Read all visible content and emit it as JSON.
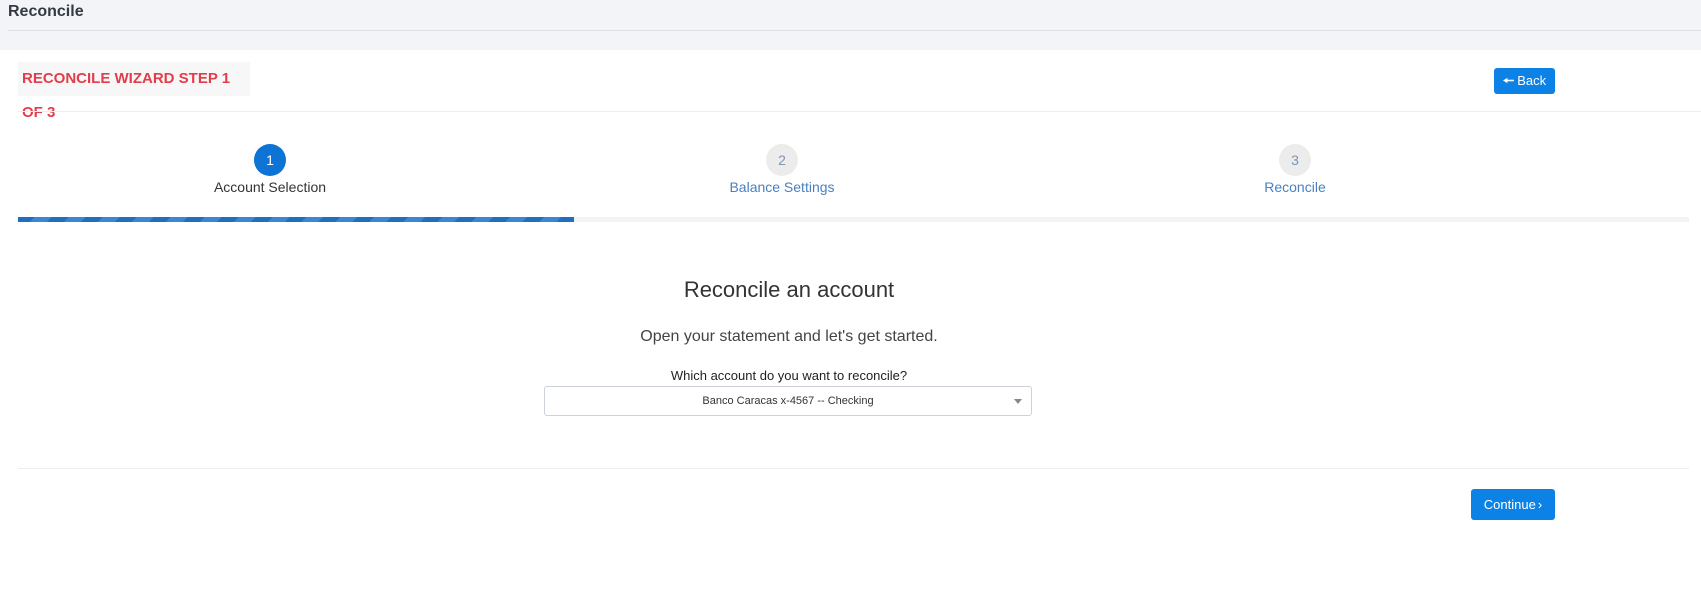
{
  "header": {
    "title": "Reconcile"
  },
  "wizard": {
    "title": "RECONCILE WIZARD STEP 1 OF 3",
    "back_label": "Back",
    "back_icon": "arrow-left-icon",
    "progress_fraction": 0.333,
    "steps": [
      {
        "number": "1",
        "label": "Account Selection",
        "active": true
      },
      {
        "number": "2",
        "label": "Balance Settings",
        "active": false
      },
      {
        "number": "3",
        "label": "Reconcile",
        "active": false
      }
    ]
  },
  "main": {
    "title": "Reconcile an account",
    "subtitle": "Open your statement and let's get started.",
    "select_label": "Which account do you want to reconcile?",
    "selected_account": "Banco Caracas x-4567 -- Checking"
  },
  "footer": {
    "continue_label": "Continue",
    "continue_icon": "chevron-right-icon"
  },
  "colors": {
    "primary": "#0d82e6",
    "title_red": "#e23d4b",
    "step_active": "#0d73d4"
  }
}
